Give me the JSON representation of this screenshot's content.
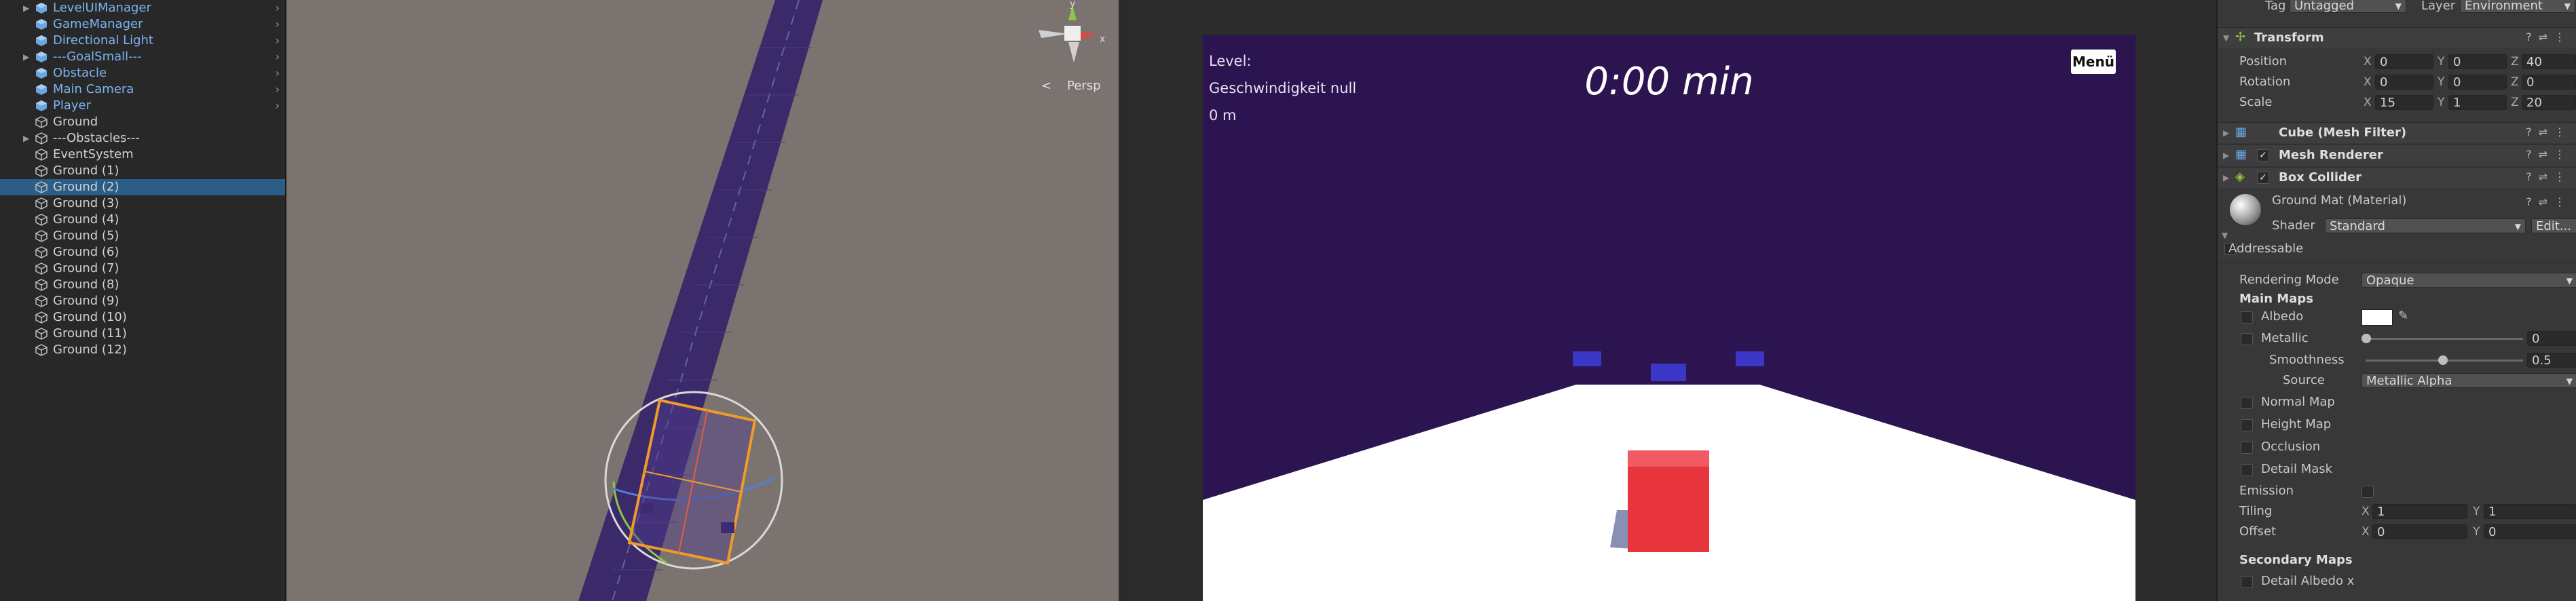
{
  "hierarchy": {
    "items": [
      {
        "label": "LevelUIManager",
        "type": "prefab",
        "fold": true,
        "arrow": true
      },
      {
        "label": "GameManager",
        "type": "prefab",
        "fold": false,
        "arrow": true
      },
      {
        "label": "Directional Light",
        "type": "prefab",
        "fold": false,
        "arrow": true
      },
      {
        "label": "---GoalSmall---",
        "type": "prefab",
        "fold": true,
        "arrow": true
      },
      {
        "label": "Obstacle",
        "type": "prefab",
        "fold": false,
        "arrow": true
      },
      {
        "label": "Main Camera",
        "type": "prefab",
        "fold": false,
        "arrow": true
      },
      {
        "label": "Player",
        "type": "prefab",
        "fold": false,
        "arrow": true
      },
      {
        "label": "Ground",
        "type": "plain",
        "fold": false,
        "arrow": false
      },
      {
        "label": "---Obstacles---",
        "type": "plain",
        "fold": true,
        "arrow": false
      },
      {
        "label": "EventSystem",
        "type": "plain",
        "fold": false,
        "arrow": false
      },
      {
        "label": "Ground (1)",
        "type": "plain",
        "fold": false,
        "arrow": false
      },
      {
        "label": "Ground (2)",
        "type": "plain",
        "fold": false,
        "arrow": false,
        "selected": true
      },
      {
        "label": "Ground (3)",
        "type": "plain",
        "fold": false,
        "arrow": false
      },
      {
        "label": "Ground (4)",
        "type": "plain",
        "fold": false,
        "arrow": false
      },
      {
        "label": "Ground (5)",
        "type": "plain",
        "fold": false,
        "arrow": false
      },
      {
        "label": "Ground (6)",
        "type": "plain",
        "fold": false,
        "arrow": false
      },
      {
        "label": "Ground (7)",
        "type": "plain",
        "fold": false,
        "arrow": false
      },
      {
        "label": "Ground (8)",
        "type": "plain",
        "fold": false,
        "arrow": false
      },
      {
        "label": "Ground (9)",
        "type": "plain",
        "fold": false,
        "arrow": false
      },
      {
        "label": "Ground (10)",
        "type": "plain",
        "fold": false,
        "arrow": false
      },
      {
        "label": "Ground (11)",
        "type": "plain",
        "fold": false,
        "arrow": false
      },
      {
        "label": "Ground (12)",
        "type": "plain",
        "fold": false,
        "arrow": false
      }
    ]
  },
  "scene": {
    "gizmo_label": "Persp",
    "axis_y": "y",
    "axis_x": "x"
  },
  "game": {
    "level_label": "Level:",
    "speed_label": "Geschwindigkeit null",
    "distance_label": "0 m",
    "timer": "0:00 min",
    "menu_button": "Menü"
  },
  "inspector": {
    "tag_label": "Tag",
    "tag_value": "Untagged",
    "layer_label": "Layer",
    "layer_value": "Environment",
    "transform": {
      "title": "Transform",
      "position_label": "Position",
      "rotation_label": "Rotation",
      "scale_label": "Scale",
      "position": {
        "x": "0",
        "y": "0",
        "z": "40"
      },
      "rotation": {
        "x": "0",
        "y": "0",
        "z": "0"
      },
      "scale": {
        "x": "15",
        "y": "1",
        "z": "20"
      }
    },
    "components": {
      "mesh_filter": "Cube (Mesh Filter)",
      "mesh_renderer": "Mesh Renderer",
      "box_collider": "Box Collider"
    },
    "material": {
      "name": "Ground Mat (Material)",
      "shader_label": "Shader",
      "shader_value": "Standard",
      "edit_button": "Edit...",
      "addressable": "Addressable",
      "rendering_mode_label": "Rendering Mode",
      "rendering_mode_value": "Opaque",
      "main_maps": "Main Maps",
      "albedo": "Albedo",
      "metallic": "Metallic",
      "metallic_value": "0",
      "smoothness": "Smoothness",
      "smoothness_value": "0.5",
      "source_label": "Source",
      "source_value": "Metallic Alpha",
      "normal_map": "Normal Map",
      "height_map": "Height Map",
      "occlusion": "Occlusion",
      "detail_mask": "Detail Mask",
      "emission": "Emission",
      "tiling_label": "Tiling",
      "offset_label": "Offset",
      "tiling": {
        "x": "1",
        "y": "1"
      },
      "offset": {
        "x": "0",
        "y": "0"
      },
      "secondary_maps": "Secondary Maps",
      "detail_albedo": "Detail Albedo x",
      "axis_x": "X",
      "axis_y": "Y",
      "axis_z": "Z"
    }
  },
  "colors": {
    "selection": "#2c5d87",
    "prefab_text": "#7cb3f0",
    "game_sky": "#2b1450",
    "player_cube": "#e8343c",
    "obstacle": "#3a36c8"
  }
}
